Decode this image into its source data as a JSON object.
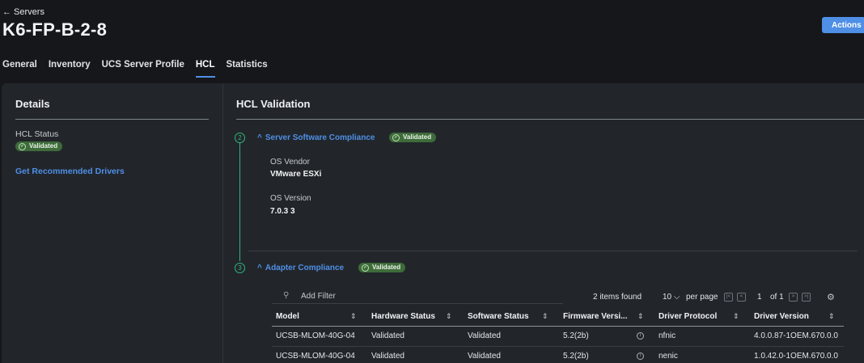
{
  "header": {
    "back_label": "← Servers",
    "title": "K6-FP-B-2-8",
    "actions_label": "Actions"
  },
  "tabs": [
    {
      "label": "General",
      "active": false
    },
    {
      "label": "Inventory",
      "active": false
    },
    {
      "label": "UCS Server Profile",
      "active": false
    },
    {
      "label": "HCL",
      "active": true
    },
    {
      "label": "Statistics",
      "active": false
    }
  ],
  "details": {
    "title": "Details",
    "hcl_status_label": "HCL Status",
    "hcl_status_value": "Validated",
    "recommended_link": "Get Recommended Drivers"
  },
  "hcl": {
    "title": "HCL Validation",
    "server_software": {
      "step": "2",
      "title": "Server Software Compliance",
      "status": "Validated",
      "os_vendor_label": "OS Vendor",
      "os_vendor_value": "VMware ESXi",
      "os_version_label": "OS Version",
      "os_version_value": "7.0.3 3"
    },
    "adapter": {
      "step": "3",
      "title": "Adapter Compliance",
      "status": "Validated",
      "filter_placeholder": "Add Filter",
      "items_found": "2 items found",
      "per_page_value": "10 ⌵",
      "per_page_label": "per page",
      "page_current": "1",
      "page_of": "of 1",
      "columns": [
        "Model",
        "Hardware Status",
        "Software Status",
        "Firmware Versi...",
        "Driver Protocol",
        "Driver Version"
      ],
      "rows": [
        {
          "model": "UCSB-MLOM-40G-04",
          "hardware_status": "Validated",
          "software_status": "Validated",
          "firmware_version": "5.2(2b)",
          "driver_protocol": "nfnic",
          "driver_version": "4.0.0.87-1OEM.670.0.0"
        },
        {
          "model": "UCSB-MLOM-40G-04",
          "hardware_status": "Validated",
          "software_status": "Validated",
          "firmware_version": "5.2(2b)",
          "driver_protocol": "nenic",
          "driver_version": "1.0.42.0-1OEM.670.0.0"
        }
      ]
    }
  },
  "icons": {
    "back": "arrow-left-icon",
    "search": "search-icon",
    "settings": "gear-icon",
    "info": "info-icon",
    "check": "check-circle-icon",
    "chevron": "chevron-up-icon"
  },
  "colors": {
    "accent": "#4f8fe6",
    "success": "#3e6b3a",
    "step": "#2fb67a",
    "background": "#15171a",
    "panel": "#22262b"
  }
}
